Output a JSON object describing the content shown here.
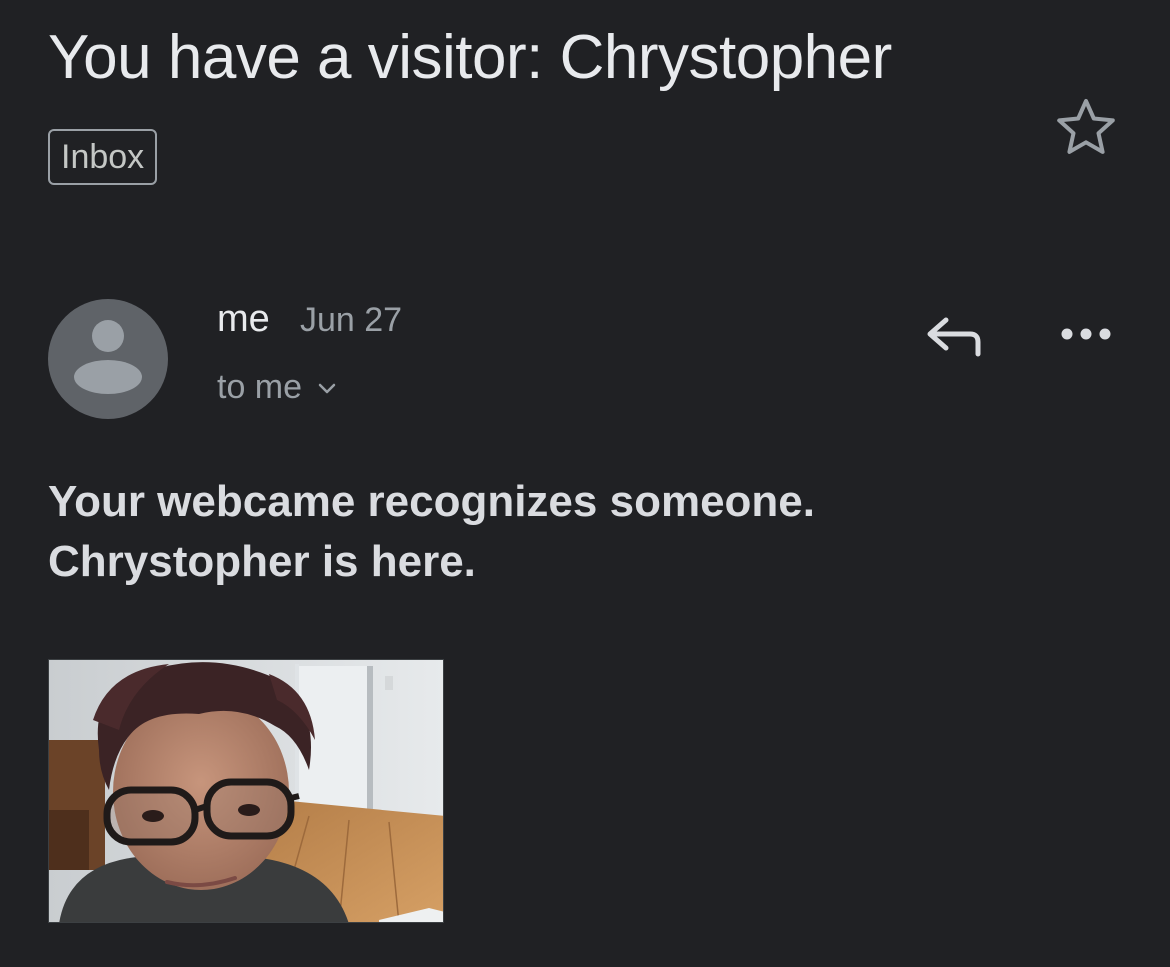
{
  "email": {
    "subject": "You have a visitor: Chrystopher",
    "label": "Inbox",
    "sender": "me",
    "date": "Jun 27",
    "recipient": "to me",
    "body_lines": [
      "Your webcame recognizes someone.",
      "Chrystopher is here."
    ]
  },
  "icons": {
    "star": "star-outline-icon",
    "reply": "reply-icon",
    "more": "more-horizontal-icon",
    "avatar": "person-avatar-icon",
    "chevron": "chevron-down-icon"
  },
  "colors": {
    "background": "#202124",
    "text_primary": "#e8eaed",
    "text_secondary": "#9aa0a6",
    "avatar_bg": "#5f6368"
  }
}
